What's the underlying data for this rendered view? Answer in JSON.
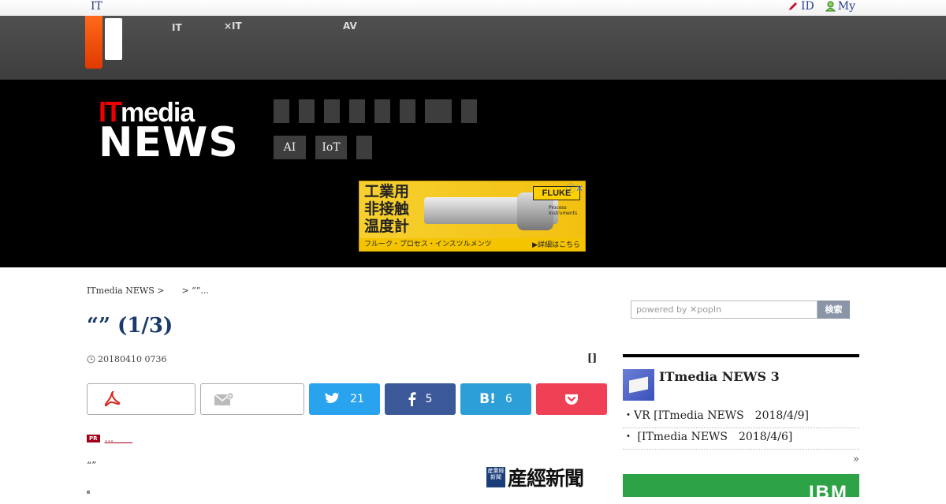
{
  "topbar": {
    "brand": "IT",
    "links": [
      {
        "label": "ID",
        "icon": "pen-icon"
      },
      {
        "label": "My",
        "icon": "user-icon"
      }
    ]
  },
  "global_nav": [
    {
      "line1": "",
      "line2": "IT"
    },
    {
      "line1": "",
      "line2": "×IT"
    },
    {
      "line1": "AV",
      "line2": ""
    }
  ],
  "header": {
    "logo_it": "IT",
    "logo_media": "media",
    "logo_news": "NEWS",
    "category_buttons": [
      "AI",
      "IoT",
      ""
    ]
  },
  "ad": {
    "headline_lines": [
      "工業用",
      "非接触",
      "温度計"
    ],
    "brand": "FLUKE",
    "brand_sub": "Process Instruments",
    "footer": "フルーク・プロセス・インスツルメンツ",
    "cta": "詳細はこちら",
    "close": "ⓘ✕"
  },
  "article": {
    "breadcrumb": "ITmedia NEWS >　　> “”...",
    "title": "“” (1/3)",
    "date": "20180410 0736",
    "bracket": "[]",
    "share": {
      "twitter_count": "21",
      "facebook_count": "5",
      "hatena_label": "B!",
      "hatena_count": "6"
    },
    "pr_badge": "PR",
    "pr_link": "...　　",
    "quote": "“”",
    "source": {
      "seal": "産業経新聞",
      "name": "産經新聞"
    }
  },
  "sidebar": {
    "search_placeholder": "powered by ✕popIn",
    "search_button": "検索",
    "section_title": "ITmedia NEWS 3",
    "items": [
      "・VR [ITmedia NEWS　2018/4/9]",
      "・ [ITmedia NEWS　2018/4/6]"
    ],
    "more": "»",
    "banner_text": "IBM"
  },
  "colors": {
    "accent_red": "#e00000",
    "twitter": "#2aa3ef",
    "facebook": "#3b5998",
    "hatena": "#2c9fd6",
    "pocket": "#ef4056",
    "title_navy": "#1a3a6a"
  }
}
